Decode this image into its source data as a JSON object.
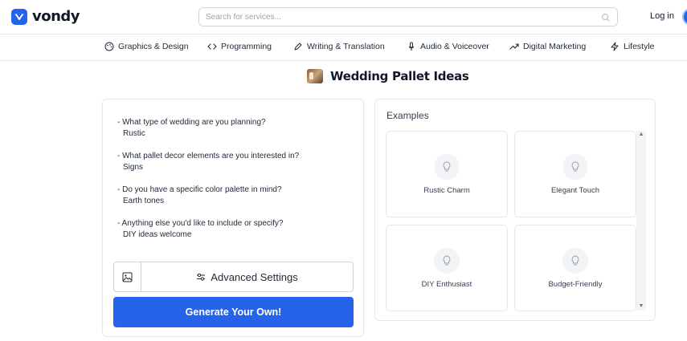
{
  "header": {
    "brand": "vondy",
    "search_placeholder": "Search for services...",
    "login_label": "Log in"
  },
  "nav": {
    "items": [
      {
        "label": "Graphics & Design",
        "icon": "palette-icon"
      },
      {
        "label": "Programming",
        "icon": "code-icon"
      },
      {
        "label": "Writing & Translation",
        "icon": "pen-icon"
      },
      {
        "label": "Audio & Voiceover",
        "icon": "microphone-icon"
      },
      {
        "label": "Digital Marketing",
        "icon": "trend-up-icon"
      },
      {
        "label": "Lifestyle",
        "icon": "lightning-icon"
      }
    ]
  },
  "page": {
    "title": "Wedding Pallet Ideas"
  },
  "form": {
    "qa": [
      {
        "q": "- What type of wedding are you planning?",
        "a": "Rustic"
      },
      {
        "q": "- What pallet decor elements are you interested in?",
        "a": "Signs"
      },
      {
        "q": "- Do you have a specific color palette in mind?",
        "a": "Earth tones"
      },
      {
        "q": "- Anything else you'd like to include or specify?",
        "a": "DIY ideas welcome"
      }
    ],
    "advanced_settings_label": "Advanced Settings",
    "generate_label": "Generate Your Own!"
  },
  "examples": {
    "label": "Examples",
    "cards": [
      {
        "label": "Rustic Charm"
      },
      {
        "label": "Elegant Touch"
      },
      {
        "label": "DIY Enthusiast"
      },
      {
        "label": "Budget-Friendly"
      }
    ]
  },
  "colors": {
    "accent": "#2563eb",
    "border": "#e5e7eb"
  }
}
